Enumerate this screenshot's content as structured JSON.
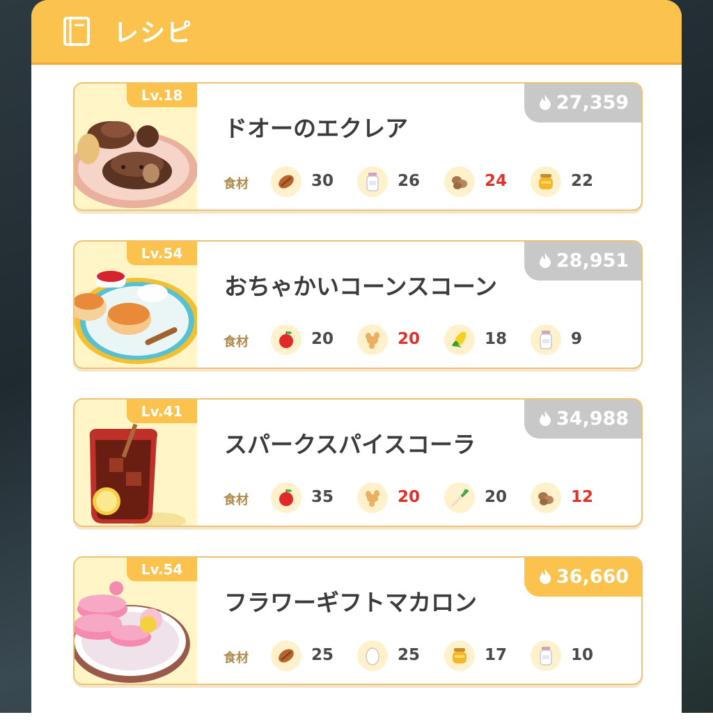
{
  "header": {
    "title": "レシピ",
    "icon": "book-icon"
  },
  "ingredient_label": "食材",
  "colors": {
    "header": "#fbc34d",
    "shortage": "#e0312a",
    "energy_default": "#c8c8c8",
    "energy_highlight": "#fbc34d"
  },
  "recipes": [
    {
      "level": "Lv.18",
      "name": "ドオーのエクレア",
      "energy": "27,359",
      "highlight": false,
      "ingredients": [
        {
          "icon": "cacao-icon",
          "count": "30",
          "short": false
        },
        {
          "icon": "milk-icon",
          "count": "26",
          "short": false
        },
        {
          "icon": "potato-icon",
          "count": "24",
          "short": true
        },
        {
          "icon": "honey-icon",
          "count": "22",
          "short": false
        }
      ]
    },
    {
      "level": "Lv.54",
      "name": "おちゃかいコーンスコーン",
      "energy": "28,951",
      "highlight": false,
      "ingredients": [
        {
          "icon": "apple-icon",
          "count": "20",
          "short": false
        },
        {
          "icon": "ginger-icon",
          "count": "20",
          "short": true
        },
        {
          "icon": "corn-icon",
          "count": "18",
          "short": false
        },
        {
          "icon": "milk-icon",
          "count": "9",
          "short": false
        }
      ]
    },
    {
      "level": "Lv.41",
      "name": "スパークスパイスコーラ",
      "energy": "34,988",
      "highlight": false,
      "ingredients": [
        {
          "icon": "apple-icon",
          "count": "35",
          "short": false
        },
        {
          "icon": "ginger-icon",
          "count": "20",
          "short": true
        },
        {
          "icon": "leek-icon",
          "count": "20",
          "short": false
        },
        {
          "icon": "potato-icon",
          "count": "12",
          "short": true
        }
      ]
    },
    {
      "level": "Lv.54",
      "name": "フラワーギフトマカロン",
      "energy": "36,660",
      "highlight": true,
      "ingredients": [
        {
          "icon": "cacao-icon",
          "count": "25",
          "short": false
        },
        {
          "icon": "egg-icon",
          "count": "25",
          "short": false
        },
        {
          "icon": "honey-icon",
          "count": "17",
          "short": false
        },
        {
          "icon": "milk-icon",
          "count": "10",
          "short": false
        }
      ]
    }
  ]
}
